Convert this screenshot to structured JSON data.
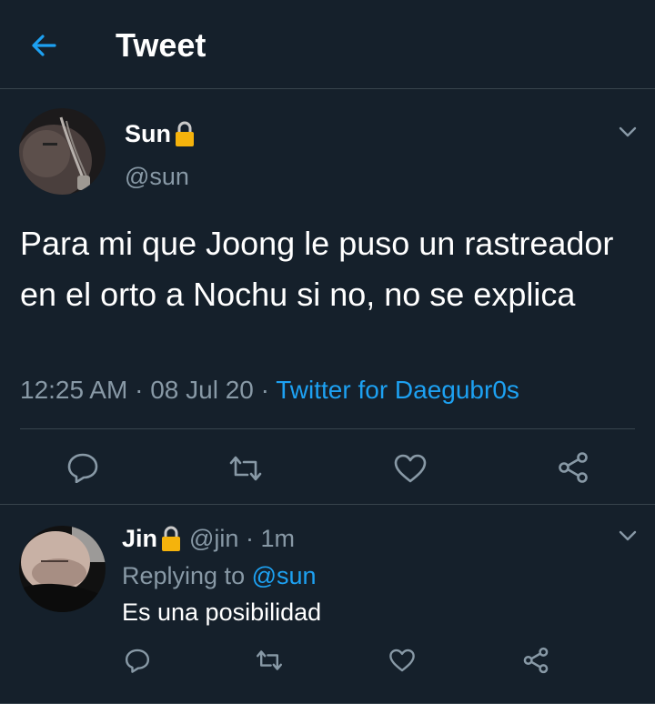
{
  "header": {
    "title": "Tweet",
    "back_icon": "arrow-left-icon"
  },
  "tweet": {
    "display_name": "Sun",
    "handle": "@sun",
    "text": "Para mi que Joong le puso un rastreador en el orto a Nochu si no, no se explica",
    "time": "12:25 AM",
    "date": "08 Jul 20",
    "source": "Twitter for Daegubr0s",
    "locked_icon": "lock-icon",
    "actions": [
      "reply-icon",
      "retweet-icon",
      "like-icon",
      "share-icon"
    ]
  },
  "reply": {
    "display_name": "Jin",
    "handle": "@jin",
    "age": "1m",
    "replying_prefix": "Replying to",
    "replying_to": "@sun",
    "text": "Es una posibilidad",
    "actions": [
      "reply-icon",
      "retweet-icon",
      "like-icon",
      "share-icon"
    ]
  },
  "colors": {
    "background": "#15202b",
    "accent": "#1da1f2",
    "muted": "#8899a6",
    "border": "#38444d",
    "lock": "#f5b30c"
  }
}
